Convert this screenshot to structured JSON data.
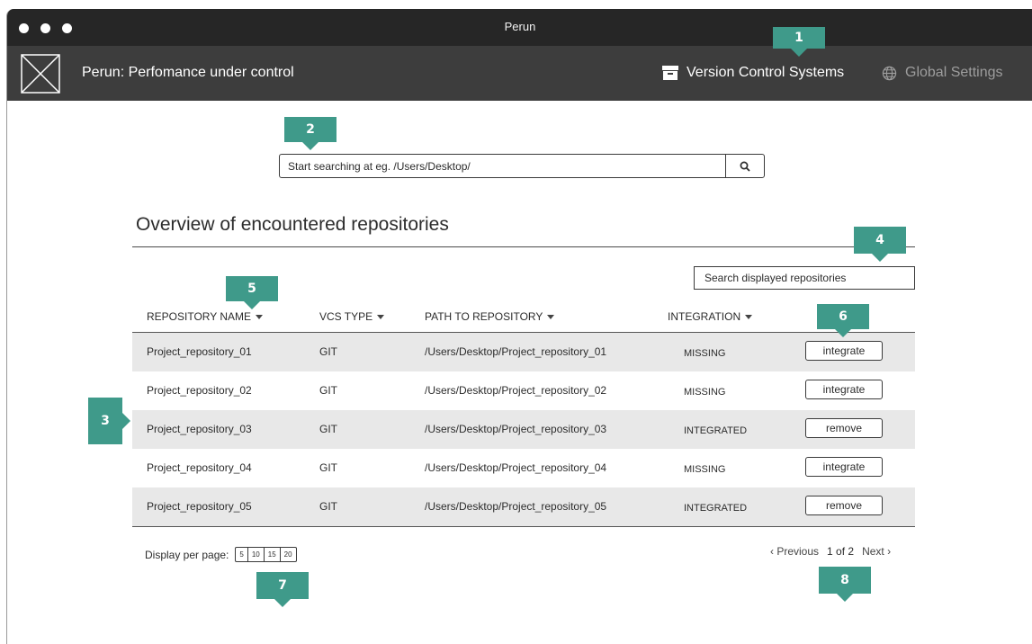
{
  "window": {
    "title": "Perun"
  },
  "app": {
    "title": "Perun: Perfomance under control"
  },
  "nav": {
    "vcs_label": "Version Control Systems",
    "global_label": "Global Settings"
  },
  "search": {
    "placeholder": "Start searching at eg. /Users/Desktop/"
  },
  "section": {
    "title": "Overview of encountered repositories"
  },
  "filter": {
    "placeholder": "Search displayed repositories"
  },
  "table": {
    "columns": [
      "REPOSITORY NAME",
      "VCS TYPE",
      "PATH TO REPOSITORY",
      "INTEGRATION"
    ],
    "rows": [
      {
        "name": "Project_repository_01",
        "vcs": "GIT",
        "path": "/Users/Desktop/Project_repository_01",
        "integration": "MISSING",
        "action": "integrate"
      },
      {
        "name": "Project_repository_02",
        "vcs": "GIT",
        "path": "/Users/Desktop/Project_repository_02",
        "integration": "MISSING",
        "action": "integrate"
      },
      {
        "name": "Project_repository_03",
        "vcs": "GIT",
        "path": "/Users/Desktop/Project_repository_03",
        "integration": "INTEGRATED",
        "action": "remove"
      },
      {
        "name": "Project_repository_04",
        "vcs": "GIT",
        "path": "/Users/Desktop/Project_repository_04",
        "integration": "MISSING",
        "action": "integrate"
      },
      {
        "name": "Project_repository_05",
        "vcs": "GIT",
        "path": "/Users/Desktop/Project_repository_05",
        "integration": "INTEGRATED",
        "action": "remove"
      }
    ]
  },
  "per_page": {
    "label": "Display per page:",
    "options": [
      "5",
      "10",
      "15",
      "20"
    ]
  },
  "pagination": {
    "previous": "‹ Previous",
    "current": "1 of 2",
    "next": "Next ›"
  },
  "callouts": [
    "1",
    "2",
    "3",
    "4",
    "5",
    "6",
    "7",
    "8"
  ],
  "colors": {
    "callout": "#3f9a8a",
    "titlebar": "#262626",
    "appbar": "#3d3d3d",
    "row_shade": "#e8e8e8"
  },
  "icons": {
    "logo": "placeholder-image-icon",
    "vcs": "archive-box-icon",
    "global": "globe-icon",
    "search": "magnifier-icon"
  }
}
